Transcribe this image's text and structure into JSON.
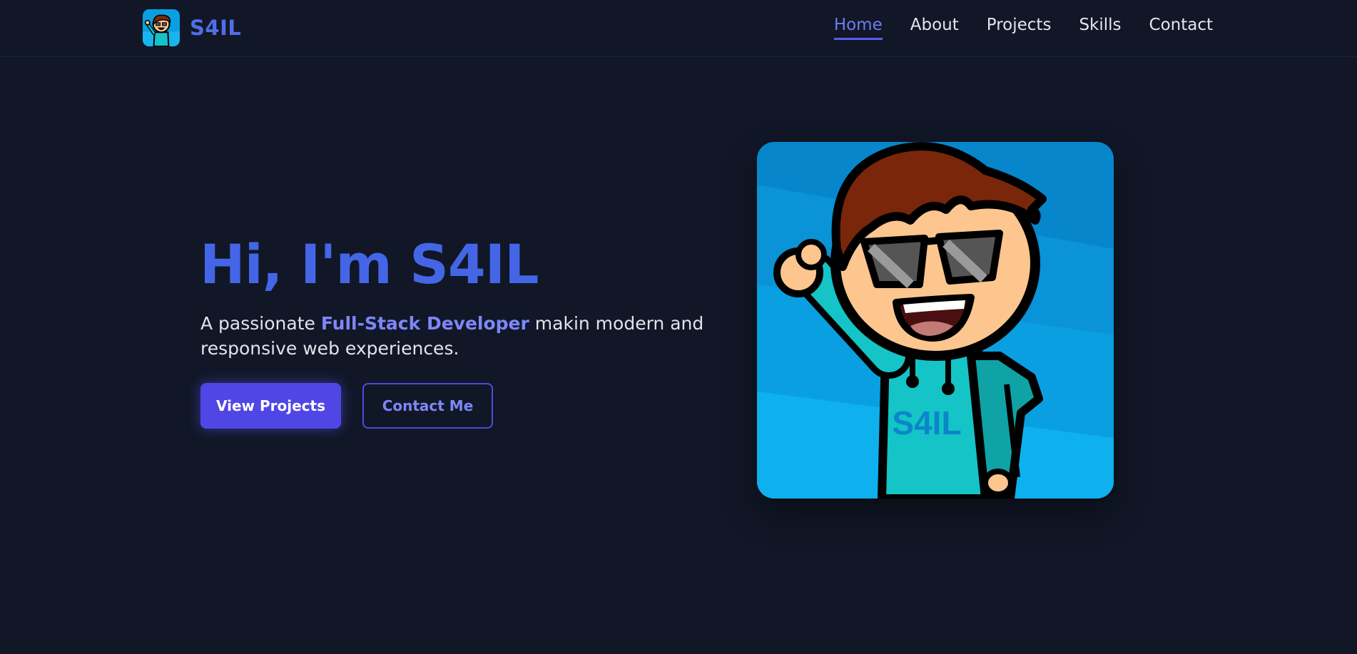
{
  "brand": {
    "name": "S4IL",
    "logo_icon": "avatar-mascot-icon"
  },
  "nav": {
    "items": [
      {
        "label": "Home",
        "active": true
      },
      {
        "label": "About",
        "active": false
      },
      {
        "label": "Projects",
        "active": false
      },
      {
        "label": "Skills",
        "active": false
      },
      {
        "label": "Contact",
        "active": false
      }
    ]
  },
  "hero": {
    "title": "Hi, I'm S4IL",
    "subtitle_before": "A passionate ",
    "subtitle_highlight": "Full-Stack Developer",
    "subtitle_after": " makin modern and responsive web experiences.",
    "primary_button": "View Projects",
    "secondary_button": "Contact Me",
    "image_icon": "mascot-avatar-illustration",
    "hoodie_text": "S4IL"
  },
  "colors": {
    "background": "#111727",
    "brand_blue": "#4466e6",
    "accent_purple": "#5046e5",
    "highlight": "#7d87f7",
    "image_bg": "#0aa6e6"
  }
}
